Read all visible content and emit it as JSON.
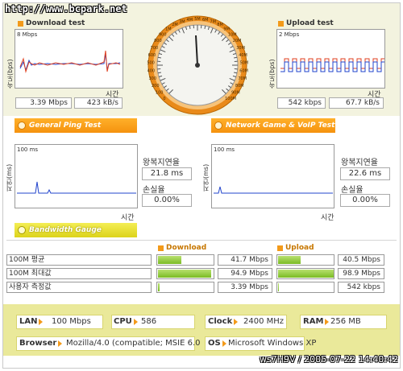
{
  "watermark": "http://www.bcpark.net",
  "download": {
    "title": "Download test",
    "ylabel": "속도(bps)",
    "scale": "8 Mbps",
    "xlabel": "시간",
    "mbps": "3.39 Mbps",
    "kbs": "423 kB/s"
  },
  "upload": {
    "title": "Upload test",
    "ylabel": "속도(bps)",
    "scale": "2 Mbps",
    "xlabel": "시간",
    "kbps": "542 kbps",
    "kbs": "67.7 kB/s"
  },
  "gauge": {
    "ticks": [
      "0",
      "100",
      "200",
      "300",
      "400",
      "500",
      "600",
      "700",
      "800",
      "900",
      "1M",
      "2M",
      "3M",
      "4M",
      "5M",
      "6M",
      "7M",
      "8M",
      "9M",
      "10M",
      "20M",
      "30M",
      "40M",
      "50M",
      "60M",
      "70M",
      "80M",
      "90M",
      "100M"
    ],
    "needle_value": "3.39 Mbps"
  },
  "buttons": {
    "ping": "General Ping Test",
    "game": "Network Game & VoIP Test",
    "bandwidth": "Bandwidth Gauge"
  },
  "ping_left": {
    "ylabel": "지연(ms)",
    "scale": "100 ms",
    "xlabel": "시간",
    "rtt_label": "왕복지연율",
    "rtt_value": "21.8 ms",
    "loss_label": "손실율",
    "loss_value": "0.00%"
  },
  "ping_right": {
    "ylabel": "지연(ms)",
    "scale": "100 ms",
    "xlabel": "시간",
    "rtt_label": "왕복지연율",
    "rtt_value": "22.6 ms",
    "loss_label": "손실율",
    "loss_value": "0.00%"
  },
  "bandwidth": {
    "download_label": "Download",
    "upload_label": "Upload",
    "rows": [
      {
        "label": "100M 평균",
        "down": "41.7 Mbps",
        "down_pct": 41.7,
        "up": "40.5 Mbps",
        "up_pct": 40.5
      },
      {
        "label": "100M 최대값",
        "down": "94.9 Mbps",
        "down_pct": 94.9,
        "up": "98.9 Mbps",
        "up_pct": 98.9
      },
      {
        "label": "사용자 측정값",
        "down": "3.39 Mbps",
        "down_pct": 3.39,
        "up": "542 kbps",
        "up_pct": 0.54
      }
    ]
  },
  "system": {
    "lan_label": "LAN",
    "lan_value": "100 Mbps",
    "cpu_label": "CPU",
    "cpu_value": "586",
    "clock_label": "Clock",
    "clock_value": "2400 MHz",
    "ram_label": "RAM",
    "ram_value": "256 MB",
    "browser_label": "Browser",
    "browser_value": "Mozilla/4.0 (compatible; MSIE 6.0",
    "os_label": "OS",
    "os_value": "Microsoft Windows XP"
  },
  "stamp": "ws7H9V / 2005-07-22 14:40:42",
  "colors": {
    "accent": "#f39a1a",
    "bar": "#7bbb24",
    "band": "#f3f3df",
    "bottom": "#eae99a"
  }
}
